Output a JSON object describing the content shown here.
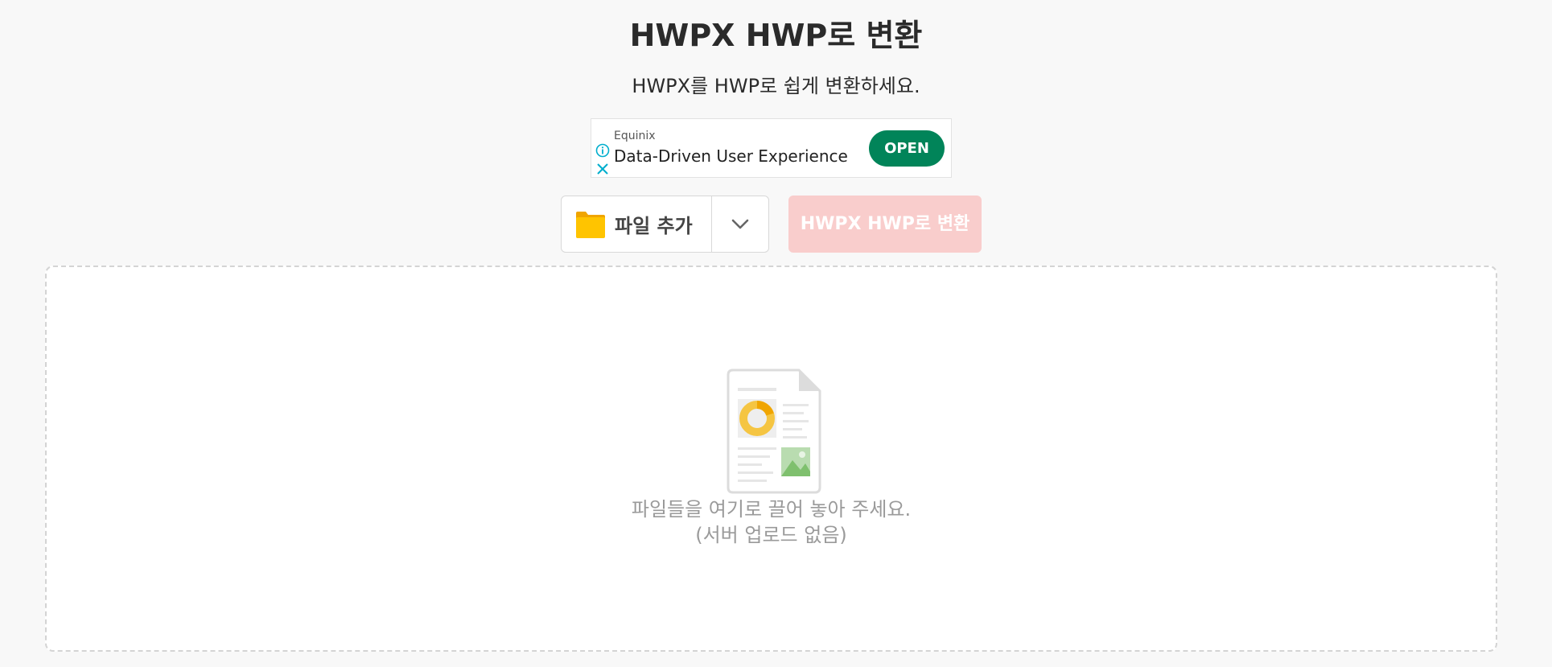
{
  "header": {
    "title": "HWPX HWP로 변환",
    "subtitle": "HWPX를 HWP로 쉽게 변환하세요."
  },
  "ad": {
    "advertiser": "Equinix",
    "headline": "Data-Driven User Experience",
    "cta_label": "OPEN",
    "cta_color": "#018459",
    "info_icon": "info-icon",
    "close_icon": "close-icon"
  },
  "toolbar": {
    "add_file_label": "파일 추가",
    "add_file_icon": "folder-icon",
    "dropdown_icon": "chevron-down-icon",
    "convert_label": "HWPX HWP로 변환",
    "convert_color": "#f9cdcc"
  },
  "dropzone": {
    "line1": "파일들을 여기로 끌어 놓아 주세요.",
    "line2": "(서버 업로드 없음)",
    "illustration_icon": "document-icon"
  }
}
